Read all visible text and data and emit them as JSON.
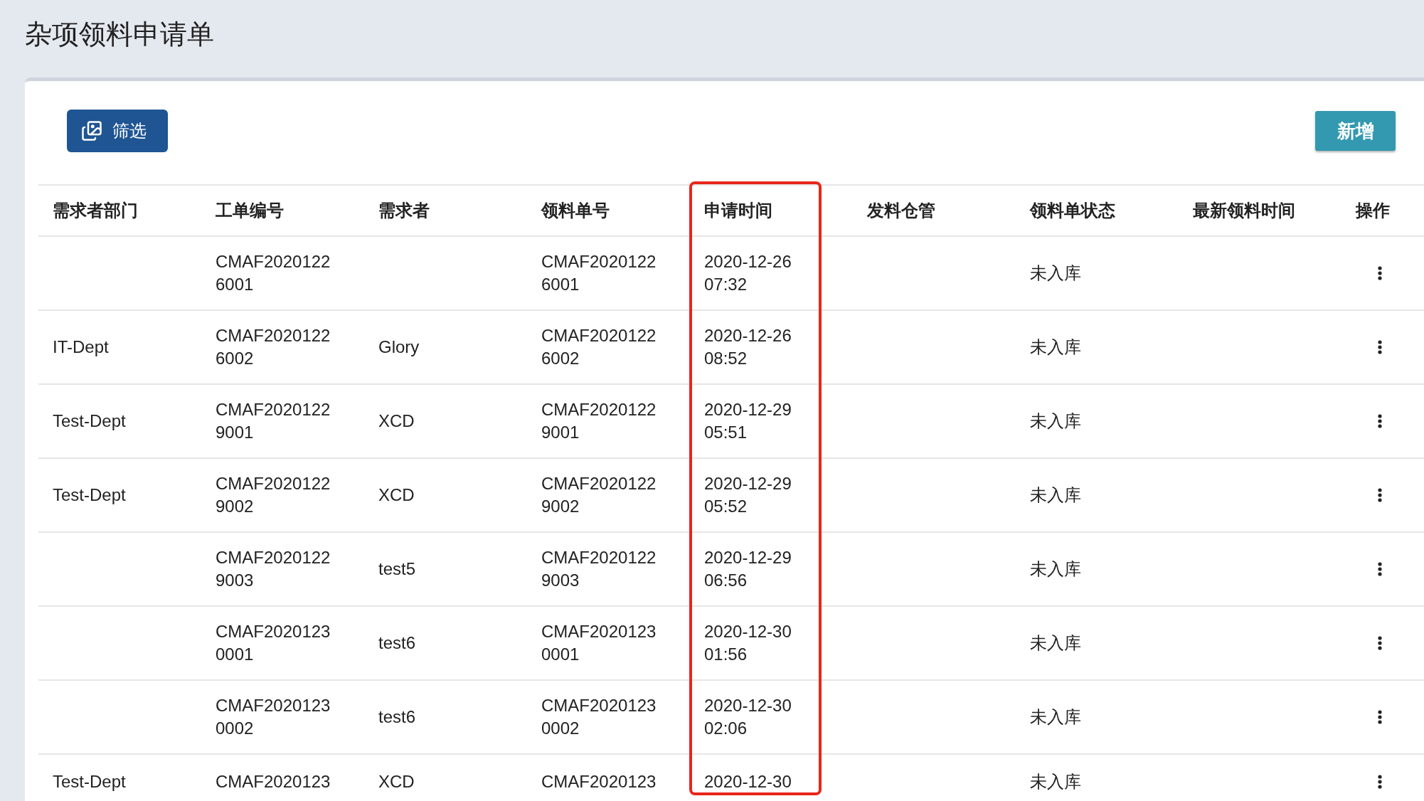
{
  "page_title": "杂项领料申请单",
  "toolbar": {
    "filter_button": "筛选",
    "add_button": "新增"
  },
  "table": {
    "columns": [
      {
        "label": "需求者部门",
        "highlighted": false
      },
      {
        "label": "工单编号",
        "highlighted": false
      },
      {
        "label": "需求者",
        "highlighted": false
      },
      {
        "label": "领料单号",
        "highlighted": false
      },
      {
        "label": "申请时间",
        "highlighted": true
      },
      {
        "label": "发料仓管",
        "highlighted": false
      },
      {
        "label": "领料单状态",
        "highlighted": false
      },
      {
        "label": "最新领料时间",
        "highlighted": false
      },
      {
        "label": "操作",
        "highlighted": false
      }
    ],
    "rows": [
      {
        "cells": [
          "",
          "CMAF2020122\n6001",
          "",
          "CMAF2020122\n6001",
          "2020-12-26\n07:32",
          "",
          "未入库",
          ""
        ]
      },
      {
        "cells": [
          "IT-Dept",
          "CMAF2020122\n6002",
          "Glory",
          "CMAF2020122\n6002",
          "2020-12-26\n08:52",
          "",
          "未入库",
          ""
        ]
      },
      {
        "cells": [
          "Test-Dept",
          "CMAF2020122\n9001",
          "XCD",
          "CMAF2020122\n9001",
          "2020-12-29\n05:51",
          "",
          "未入库",
          ""
        ]
      },
      {
        "cells": [
          "Test-Dept",
          "CMAF2020122\n9002",
          "XCD",
          "CMAF2020122\n9002",
          "2020-12-29\n05:52",
          "",
          "未入库",
          ""
        ]
      },
      {
        "cells": [
          "",
          "CMAF2020122\n9003",
          "test5",
          "CMAF2020122\n9003",
          "2020-12-29\n06:56",
          "",
          "未入库",
          ""
        ]
      },
      {
        "cells": [
          "",
          "CMAF2020123\n0001",
          "test6",
          "CMAF2020123\n0001",
          "2020-12-30\n01:56",
          "",
          "未入库",
          ""
        ]
      },
      {
        "cells": [
          "",
          "CMAF2020123\n0002",
          "test6",
          "CMAF2020123\n0002",
          "2020-12-30\n02:06",
          "",
          "未入库",
          ""
        ]
      },
      {
        "cut_off": true,
        "cells": [
          "Test-Dept",
          "CMAF2020123",
          "XCD",
          "CMAF2020123",
          "2020-12-30",
          "",
          "未入库",
          ""
        ]
      }
    ]
  }
}
